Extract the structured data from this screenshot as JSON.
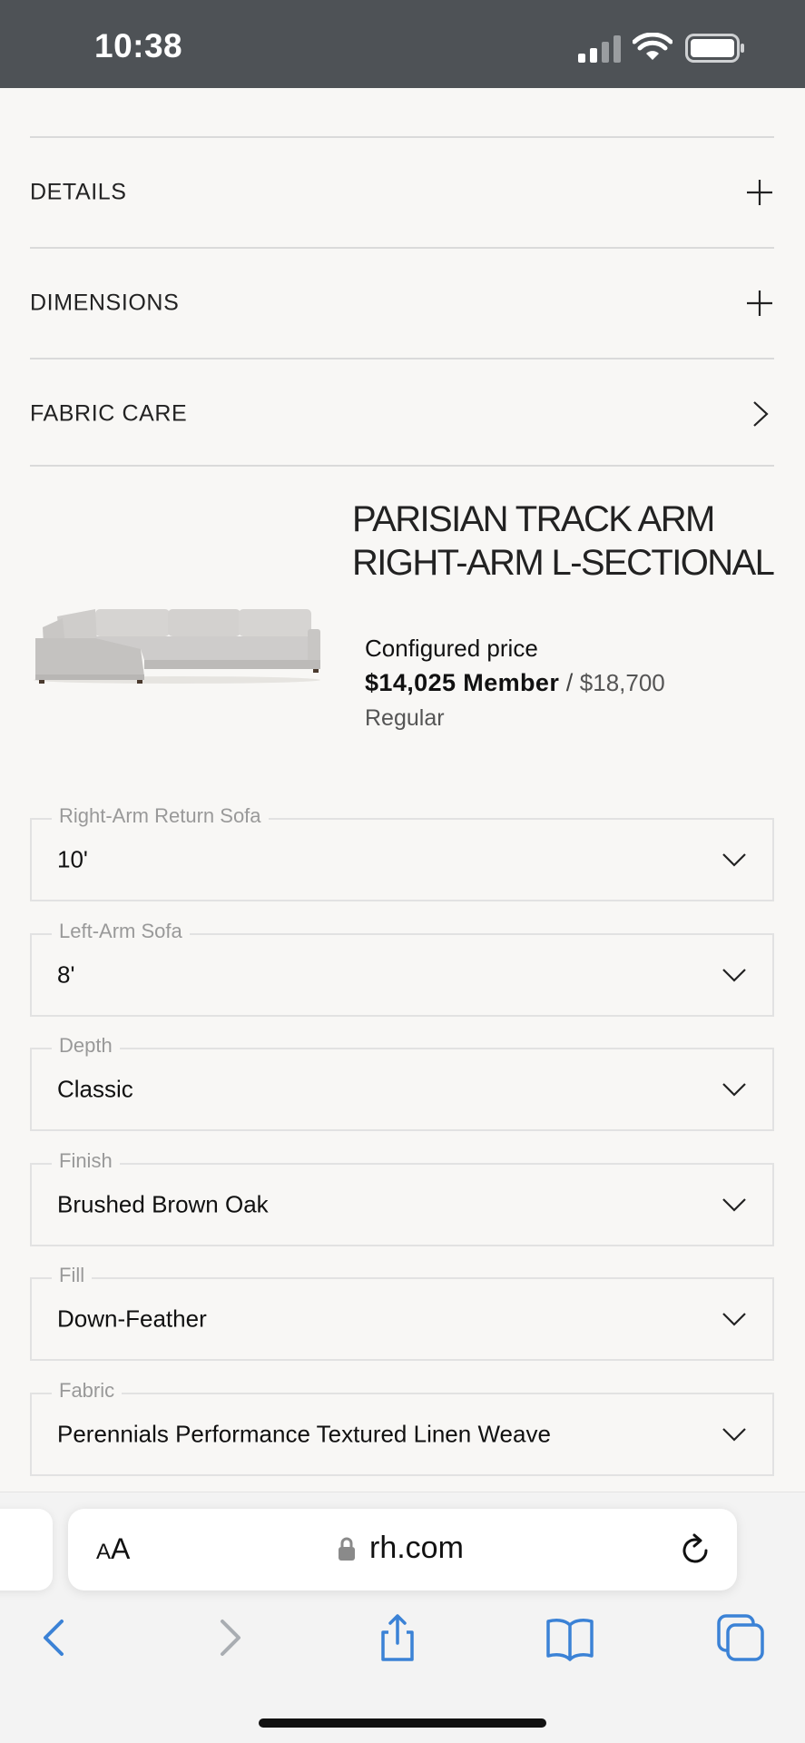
{
  "status_bar": {
    "time": "10:38"
  },
  "accordion": [
    {
      "label": "DETAILS",
      "icon": "plus-icon"
    },
    {
      "label": "DIMENSIONS",
      "icon": "plus-icon"
    },
    {
      "label": "FABRIC CARE",
      "icon": "chevron-right-icon"
    }
  ],
  "product": {
    "title": "PARISIAN TRACK ARM RIGHT-ARM L-SECTIONAL",
    "price_label": "Configured price",
    "member_price": "$14,025 Member",
    "separator": "/",
    "regular_price": "$18,700",
    "regular_label": "Regular"
  },
  "options": [
    {
      "label": "Right-Arm Return Sofa",
      "value": "10'"
    },
    {
      "label": "Left-Arm Sofa",
      "value": "8'"
    },
    {
      "label": "Depth",
      "value": "Classic"
    },
    {
      "label": "Finish",
      "value": "Brushed Brown Oak"
    },
    {
      "label": "Fill",
      "value": "Down-Feather"
    },
    {
      "label": "Fabric",
      "value": "Perennials Performance Textured Linen Weave"
    }
  ],
  "browser": {
    "aa_small": "A",
    "aa_large": "A",
    "url": "rh.com"
  },
  "colors": {
    "status_bar": "#4e5256",
    "page_bg": "#f8f7f5",
    "safari_blue": "#3b82d6"
  }
}
